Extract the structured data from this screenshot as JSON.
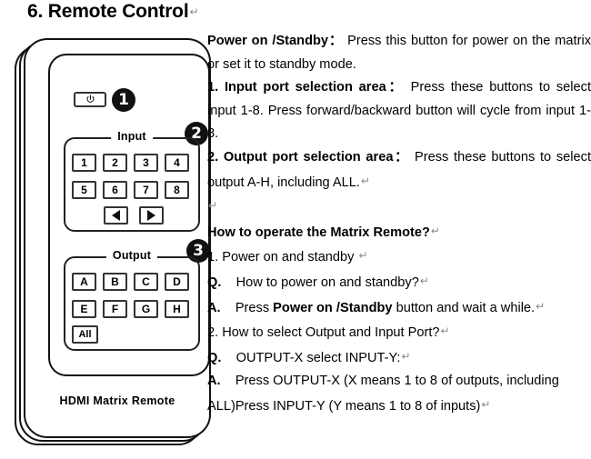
{
  "page": {
    "title": "6. Remote Control",
    "paragraph_mark": "↵"
  },
  "remote": {
    "brand_label": "HDMI  Matrix Remote",
    "power_key": {
      "icon": "power-icon"
    },
    "callouts": [
      {
        "id": 1,
        "label": "1"
      },
      {
        "id": 2,
        "label": "2"
      },
      {
        "id": 3,
        "label": "3"
      }
    ],
    "input_group": {
      "legend": "Input",
      "row1": [
        "1",
        "2",
        "3",
        "4"
      ],
      "row2": [
        "5",
        "6",
        "7",
        "8"
      ],
      "arrows": [
        "backward-arrow-icon",
        "forward-arrow-icon"
      ]
    },
    "output_group": {
      "legend": "Output",
      "row1": [
        "A",
        "B",
        "C",
        "D"
      ],
      "row2": [
        "E",
        "F",
        "G",
        "H"
      ],
      "row3": [
        "All"
      ]
    }
  },
  "copy": {
    "p1_bold": "Power on /Standby：",
    "p1_rest": "Press this button for power on the matrix or set it to standby mode.",
    "p2_bold": "1.    Input port selection area：",
    "p2_rest": "Press these buttons to select input 1-8. Press forward/backward button will cycle from input 1-8.",
    "p3_bold": "2.    Output port selection area：",
    "p3_rest": "Press these buttons to select output A-H, including ALL.",
    "heading": "How to operate the Matrix Remote?",
    "q1_line": "1. Power on and standby ",
    "q1_label": "Q.",
    "q1_text": "How to power on and standby?",
    "a1_label": "A.",
    "a1_pre": "Press ",
    "a1_bold": "Power on /Standby",
    "a1_post": " button and wait a while.",
    "q2_line": "2. How to select Output and Input Port?",
    "q2_label": "Q.",
    "q2_text": "OUTPUT-X select INPUT-Y:",
    "a2_label": "A.",
    "a2_text": "Press OUTPUT-X (X means 1 to 8 of      outputs, including ALL)Press INPUT-Y (Y means 1 to 8 of inputs)"
  }
}
